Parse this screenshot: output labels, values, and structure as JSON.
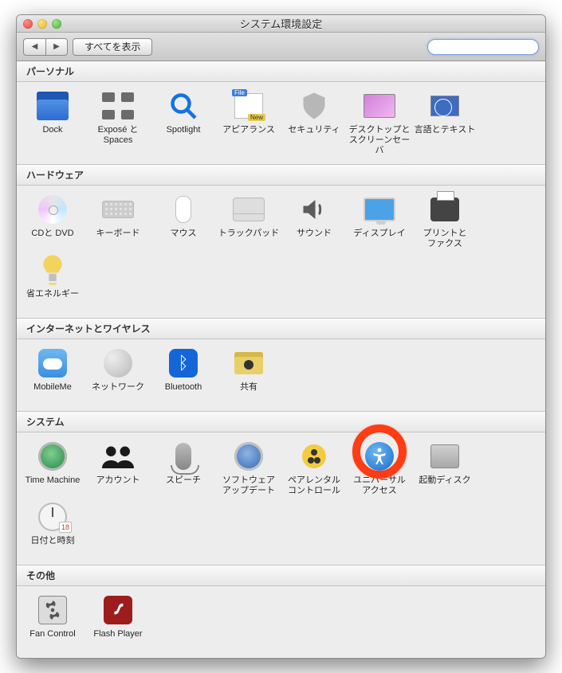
{
  "window": {
    "title": "システム環境設定"
  },
  "toolbar": {
    "show_all": "すべてを表示",
    "search_placeholder": ""
  },
  "sections": {
    "personal": {
      "title": "パーソナル"
    },
    "hardware": {
      "title": "ハードウェア"
    },
    "network": {
      "title": "インターネットとワイヤレス"
    },
    "system": {
      "title": "システム"
    },
    "other": {
      "title": "その他"
    }
  },
  "items": {
    "dock": {
      "label": "Dock"
    },
    "expose": {
      "label": "Exposé と\nSpaces"
    },
    "spotlight": {
      "label": "Spotlight"
    },
    "appearance": {
      "label": "アピアランス"
    },
    "security": {
      "label": "セキュリティ"
    },
    "desktop": {
      "label": "デスクトップと\nスクリーンセーバ"
    },
    "language": {
      "label": "言語とテキスト"
    },
    "cddvd": {
      "label": "CDと DVD"
    },
    "keyboard": {
      "label": "キーボード"
    },
    "mouse": {
      "label": "マウス"
    },
    "trackpad": {
      "label": "トラックパッド"
    },
    "sound": {
      "label": "サウンド"
    },
    "display": {
      "label": "ディスプレイ"
    },
    "printfax": {
      "label": "プリントと\nファクス"
    },
    "energy": {
      "label": "省エネルギー"
    },
    "mobileme": {
      "label": "MobileMe"
    },
    "networkpref": {
      "label": "ネットワーク"
    },
    "bluetooth": {
      "label": "Bluetooth"
    },
    "sharing": {
      "label": "共有"
    },
    "timemachine": {
      "label": "Time Machine"
    },
    "accounts": {
      "label": "アカウント"
    },
    "speech": {
      "label": "スピーチ"
    },
    "swupdate": {
      "label": "ソフトウェア\nアップデート"
    },
    "parental": {
      "label": "ペアレンタル\nコントロール"
    },
    "universal": {
      "label": "ユニバーサル\nアクセス"
    },
    "startup": {
      "label": "起動ディスク"
    },
    "datetime": {
      "label": "日付と時刻"
    },
    "fancontrol": {
      "label": "Fan Control"
    },
    "flashplayer": {
      "label": "Flash Player"
    }
  }
}
